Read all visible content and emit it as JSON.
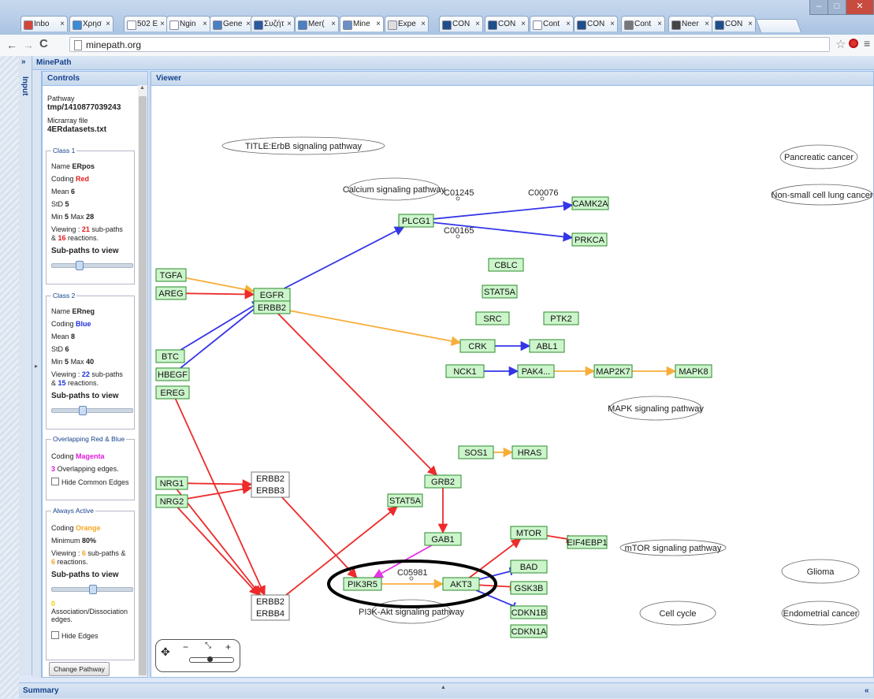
{
  "browser": {
    "tabs": [
      {
        "label": "Inbo",
        "color": "#d44638"
      },
      {
        "label": "Χρησ",
        "color": "#3b8bd6"
      },
      {
        "label": "502 E",
        "color": "#ffffff"
      },
      {
        "label": "Ngin",
        "color": "#ffffff"
      },
      {
        "label": "Gene",
        "color": "#4a7fc1"
      },
      {
        "label": "Συζήτ",
        "color": "#2a5aa0"
      },
      {
        "label": "Mer(",
        "color": "#4a7fc1"
      },
      {
        "label": "Mine",
        "color": "#6b8fc7",
        "active": true
      },
      {
        "label": "Expe",
        "color": "#dddddd"
      },
      {
        "label": "CON",
        "color": "#1e4f8a"
      },
      {
        "label": "CON",
        "color": "#1e4f8a"
      },
      {
        "label": "Cont",
        "color": "#ffffff"
      },
      {
        "label": "CON",
        "color": "#1e4f8a"
      },
      {
        "label": "Cont",
        "color": "#777777"
      },
      {
        "label": "Neer",
        "color": "#444444"
      },
      {
        "label": "CON",
        "color": "#1e4f8a"
      }
    ],
    "url": "minepath.org"
  },
  "app": {
    "title": "MinePath",
    "input_tab": "Input",
    "controls_title": "Controls",
    "viewer_title": "Viewer",
    "summary_title": "Summary",
    "change_pathway": "Change Pathway"
  },
  "controls": {
    "pathway_label": "Pathway",
    "pathway_value": "tmp/1410877039243",
    "micro_label": "Micrarray file",
    "micro_value": "4ERdatasets.txt",
    "class1": {
      "legend": "Class 1",
      "name_label": "Name",
      "name": "ERpos",
      "coding_label": "Coding",
      "coding": "Red",
      "coding_color": "#e21b1b",
      "mean_label": "Mean",
      "mean": "6",
      "std_label": "StD",
      "std": "5",
      "min_label": "Min",
      "min": "5",
      "max_label": "Max",
      "max": "28",
      "view_pre": "Viewing : ",
      "subpaths": "21",
      "view_mid": " sub-paths",
      "view_amp": "& ",
      "reactions": "16",
      "view_post": " reactions.",
      "subpaths_view": "Sub-paths to view"
    },
    "class2": {
      "legend": "Class 2",
      "name_label": "Name",
      "name": "ERneg",
      "coding_label": "Coding",
      "coding": "Blue",
      "coding_color": "#1b2fe0",
      "mean_label": "Mean",
      "mean": "8",
      "std_label": "StD",
      "std": "6",
      "min_label": "Min",
      "min": "5",
      "max_label": "Max",
      "max": "40",
      "view_pre": "Viewing : ",
      "subpaths": "22",
      "view_mid": " sub-paths",
      "view_amp": "& ",
      "reactions": "15",
      "view_post": " reactions.",
      "subpaths_view": "Sub-paths to view"
    },
    "overlap": {
      "legend": "Overlapping Red & Blue",
      "coding_label": "Coding",
      "coding": "Magenta",
      "coding_color": "#e01be0",
      "count": "3",
      "text": " Overlapping edges.",
      "hide": "Hide Common Edges"
    },
    "always": {
      "legend": "Always Active",
      "coding_label": "Coding",
      "coding": "Orange",
      "coding_color": "#f5a623",
      "min_label": "Minimum",
      "min": "80%",
      "view_pre": "Viewing : ",
      "subpaths": "6",
      "view_mid": " sub-paths &",
      "reactions": "6",
      "view_post": " reactions.",
      "subpaths_view": "Sub-paths to view",
      "assoc_count": "0",
      "assoc_text": "Association/Dissociation edges.",
      "hide": "Hide Edges"
    }
  },
  "graph": {
    "colors": {
      "red": "#ee2a2a",
      "blue": "#3535e8",
      "orange": "#f8ae3a",
      "magenta": "#e633e6",
      "node_fill": "#ccf5cc",
      "node_border": "#2b8a2b"
    },
    "pathways": [
      {
        "id": "title",
        "label": "TITLE:ErbB signaling pathway"
      },
      {
        "id": "calcium",
        "label": "Calcium signaling pathway"
      },
      {
        "id": "mapk",
        "label": "MAPK signaling pathway"
      },
      {
        "id": "mtor",
        "label": "mTOR signaling pathway"
      },
      {
        "id": "pi3k",
        "label": "PI3K-Akt signaling pathway"
      },
      {
        "id": "cellcycle",
        "label": "Cell cycle"
      },
      {
        "id": "pancreatic",
        "label": "Pancreatic cancer"
      },
      {
        "id": "nsclc",
        "label": "Non-small cell lung cancer"
      },
      {
        "id": "glioma",
        "label": "Glioma"
      },
      {
        "id": "endometrial",
        "label": "Endometrial cancer"
      }
    ],
    "compounds": [
      {
        "id": "c01245",
        "label": "C01245"
      },
      {
        "id": "c00076",
        "label": "C00076"
      },
      {
        "id": "c00165",
        "label": "C00165"
      },
      {
        "id": "c05981",
        "label": "C05981"
      }
    ],
    "genes": [
      {
        "id": "TGFA",
        "label": "TGFA"
      },
      {
        "id": "AREG",
        "label": "AREG"
      },
      {
        "id": "EGFR",
        "label": "EGFR"
      },
      {
        "id": "ERBB2a",
        "label": "ERBB2"
      },
      {
        "id": "BTC",
        "label": "BTC"
      },
      {
        "id": "HBEGF",
        "label": "HBEGF"
      },
      {
        "id": "EREG",
        "label": "EREG"
      },
      {
        "id": "PLCG1",
        "label": "PLCG1"
      },
      {
        "id": "CAMK2A",
        "label": "CAMK2A"
      },
      {
        "id": "PRKCA",
        "label": "PRKCA"
      },
      {
        "id": "CBLC",
        "label": "CBLC"
      },
      {
        "id": "STAT5Aa",
        "label": "STAT5A"
      },
      {
        "id": "SRC",
        "label": "SRC"
      },
      {
        "id": "PTK2",
        "label": "PTK2"
      },
      {
        "id": "CRK",
        "label": "CRK"
      },
      {
        "id": "ABL1",
        "label": "ABL1"
      },
      {
        "id": "NCK1",
        "label": "NCK1"
      },
      {
        "id": "PAK4",
        "label": "PAK4..."
      },
      {
        "id": "MAP2K7",
        "label": "MAP2K7"
      },
      {
        "id": "MAPK8",
        "label": "MAPK8"
      },
      {
        "id": "SOS1",
        "label": "SOS1"
      },
      {
        "id": "HRAS",
        "label": "HRAS"
      },
      {
        "id": "GRB2",
        "label": "GRB2"
      },
      {
        "id": "STAT5Ab",
        "label": "STAT5A"
      },
      {
        "id": "GAB1",
        "label": "GAB1"
      },
      {
        "id": "NRG1",
        "label": "NRG1"
      },
      {
        "id": "NRG2",
        "label": "NRG2"
      },
      {
        "id": "PIK3R5",
        "label": "PIK3R5"
      },
      {
        "id": "AKT3",
        "label": "AKT3"
      },
      {
        "id": "MTOR",
        "label": "MTOR"
      },
      {
        "id": "EIF4EBP1",
        "label": "EIF4EBP1"
      },
      {
        "id": "BAD",
        "label": "BAD"
      },
      {
        "id": "GSK3B",
        "label": "GSK3B"
      },
      {
        "id": "CDKN1B",
        "label": "CDKN1B"
      },
      {
        "id": "CDKN1A",
        "label": "CDKN1A"
      }
    ],
    "complexes": [
      {
        "id": "c23",
        "labels": [
          "ERBB2",
          "ERBB3"
        ]
      },
      {
        "id": "c24",
        "labels": [
          "ERBB2",
          "ERBB4"
        ]
      }
    ],
    "edges": [
      {
        "from": "TGFA",
        "to": "EGFR",
        "color": "orange"
      },
      {
        "from": "AREG",
        "to": "EGFR",
        "color": "red"
      },
      {
        "from": "BTC",
        "to": "EGFR",
        "color": "blue"
      },
      {
        "from": "HBEGF",
        "to": "EGFR",
        "color": "blue"
      },
      {
        "from": "EGFR",
        "to": "PLCG1",
        "color": "blue"
      },
      {
        "from": "PLCG1",
        "to": "CAMK2A",
        "color": "blue"
      },
      {
        "from": "PLCG1",
        "to": "PRKCA",
        "color": "blue"
      },
      {
        "from": "ERBB2a",
        "to": "CRK",
        "color": "orange"
      },
      {
        "from": "CRK",
        "to": "ABL1",
        "color": "blue"
      },
      {
        "from": "NCK1",
        "to": "PAK4",
        "color": "blue"
      },
      {
        "from": "PAK4",
        "to": "MAP2K7",
        "color": "orange"
      },
      {
        "from": "MAP2K7",
        "to": "MAPK8",
        "color": "orange"
      },
      {
        "from": "SOS1",
        "to": "HRAS",
        "color": "orange"
      },
      {
        "from": "ERBB2a",
        "to": "GRB2",
        "color": "red"
      },
      {
        "from": "GRB2",
        "to": "GAB1",
        "color": "red"
      },
      {
        "from": "GAB1",
        "to": "PIK3R5",
        "color": "magenta"
      },
      {
        "from": "PIK3R5",
        "to": "AKT3",
        "color": "orange"
      },
      {
        "from": "AKT3",
        "to": "MTOR",
        "color": "red"
      },
      {
        "from": "MTOR",
        "to": "EIF4EBP1",
        "color": "red"
      },
      {
        "from": "AKT3",
        "to": "BAD",
        "color": "blue"
      },
      {
        "from": "AKT3",
        "to": "GSK3B",
        "color": "red"
      },
      {
        "from": "AKT3",
        "to": "CDKN1B",
        "color": "blue"
      },
      {
        "from": "NRG1",
        "to": "c23",
        "color": "red"
      },
      {
        "from": "NRG2",
        "to": "c23",
        "color": "red"
      },
      {
        "from": "NRG1",
        "to": "c24",
        "color": "red"
      },
      {
        "from": "NRG2",
        "to": "c24",
        "color": "red"
      },
      {
        "from": "EREG",
        "to": "c24",
        "color": "red"
      },
      {
        "from": "c24",
        "to": "STAT5Ab",
        "color": "red"
      },
      {
        "from": "c23",
        "to": "PIK3R5",
        "color": "red"
      }
    ]
  }
}
